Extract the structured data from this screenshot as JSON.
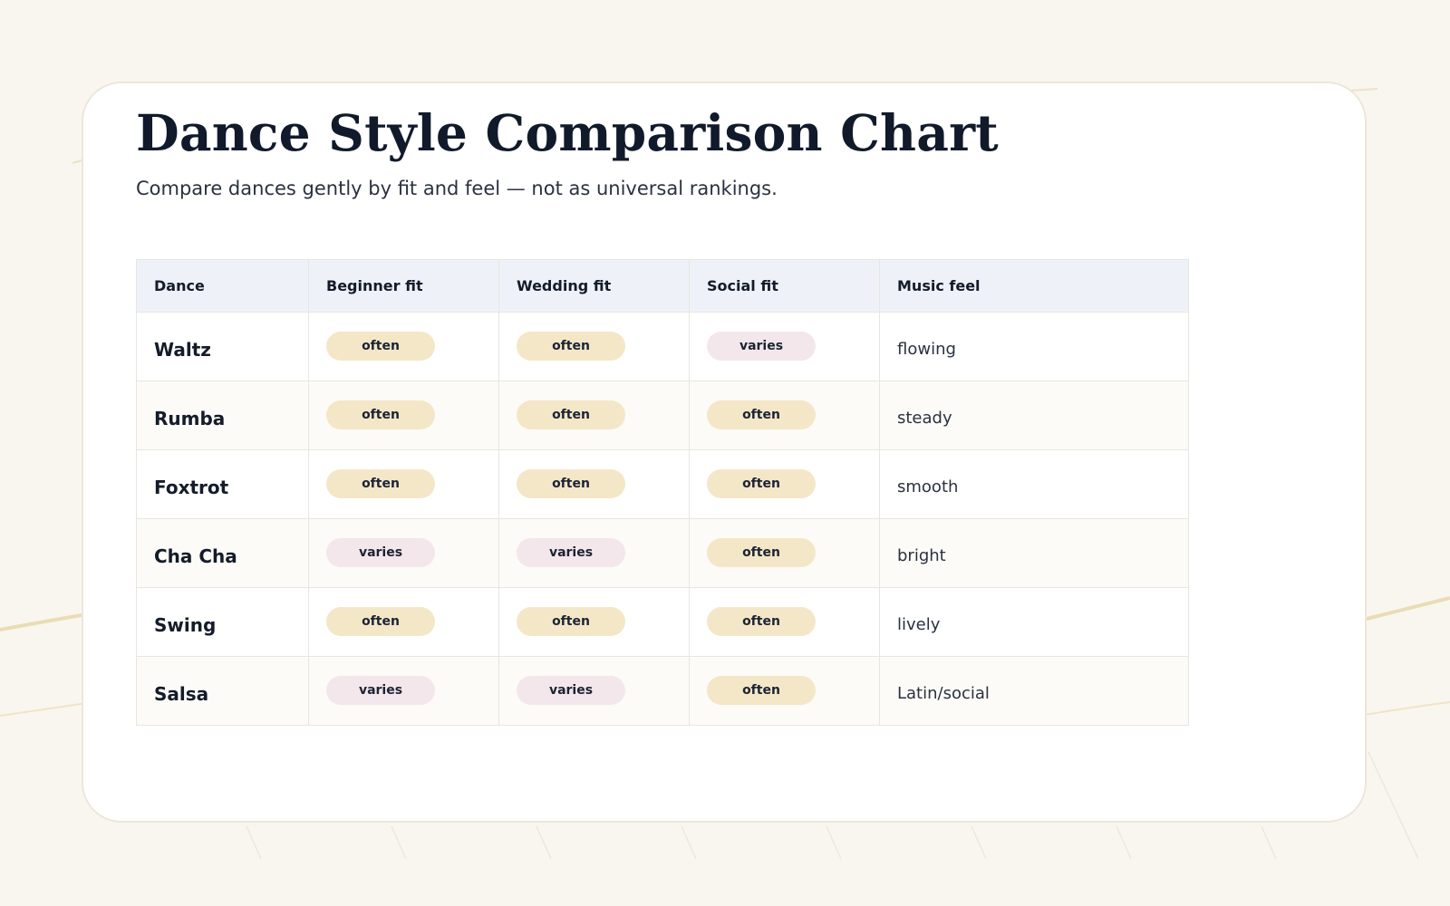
{
  "title": "Dance Style Comparison Chart",
  "subtitle": "Compare dances gently by fit and feel — not as universal rankings.",
  "colors": {
    "page_background": "#f9f6ef",
    "header_background": "#eef2f8",
    "often_pill": "#f4e7c8",
    "varies_pill": "#f3e7ec",
    "title_text": "#111a2b"
  },
  "table": {
    "columns": [
      "Dance",
      "Beginner fit",
      "Wedding fit",
      "Social fit",
      "Music feel"
    ],
    "rows": [
      {
        "dance": "Waltz",
        "beginner": "often",
        "wedding": "often",
        "social": "varies",
        "music": "flowing"
      },
      {
        "dance": "Rumba",
        "beginner": "often",
        "wedding": "often",
        "social": "often",
        "music": "steady"
      },
      {
        "dance": "Foxtrot",
        "beginner": "often",
        "wedding": "often",
        "social": "often",
        "music": "smooth"
      },
      {
        "dance": "Cha Cha",
        "beginner": "varies",
        "wedding": "varies",
        "social": "often",
        "music": "bright"
      },
      {
        "dance": "Swing",
        "beginner": "often",
        "wedding": "often",
        "social": "often",
        "music": "lively"
      },
      {
        "dance": "Salsa",
        "beginner": "varies",
        "wedding": "varies",
        "social": "often",
        "music": "Latin/social"
      }
    ]
  }
}
